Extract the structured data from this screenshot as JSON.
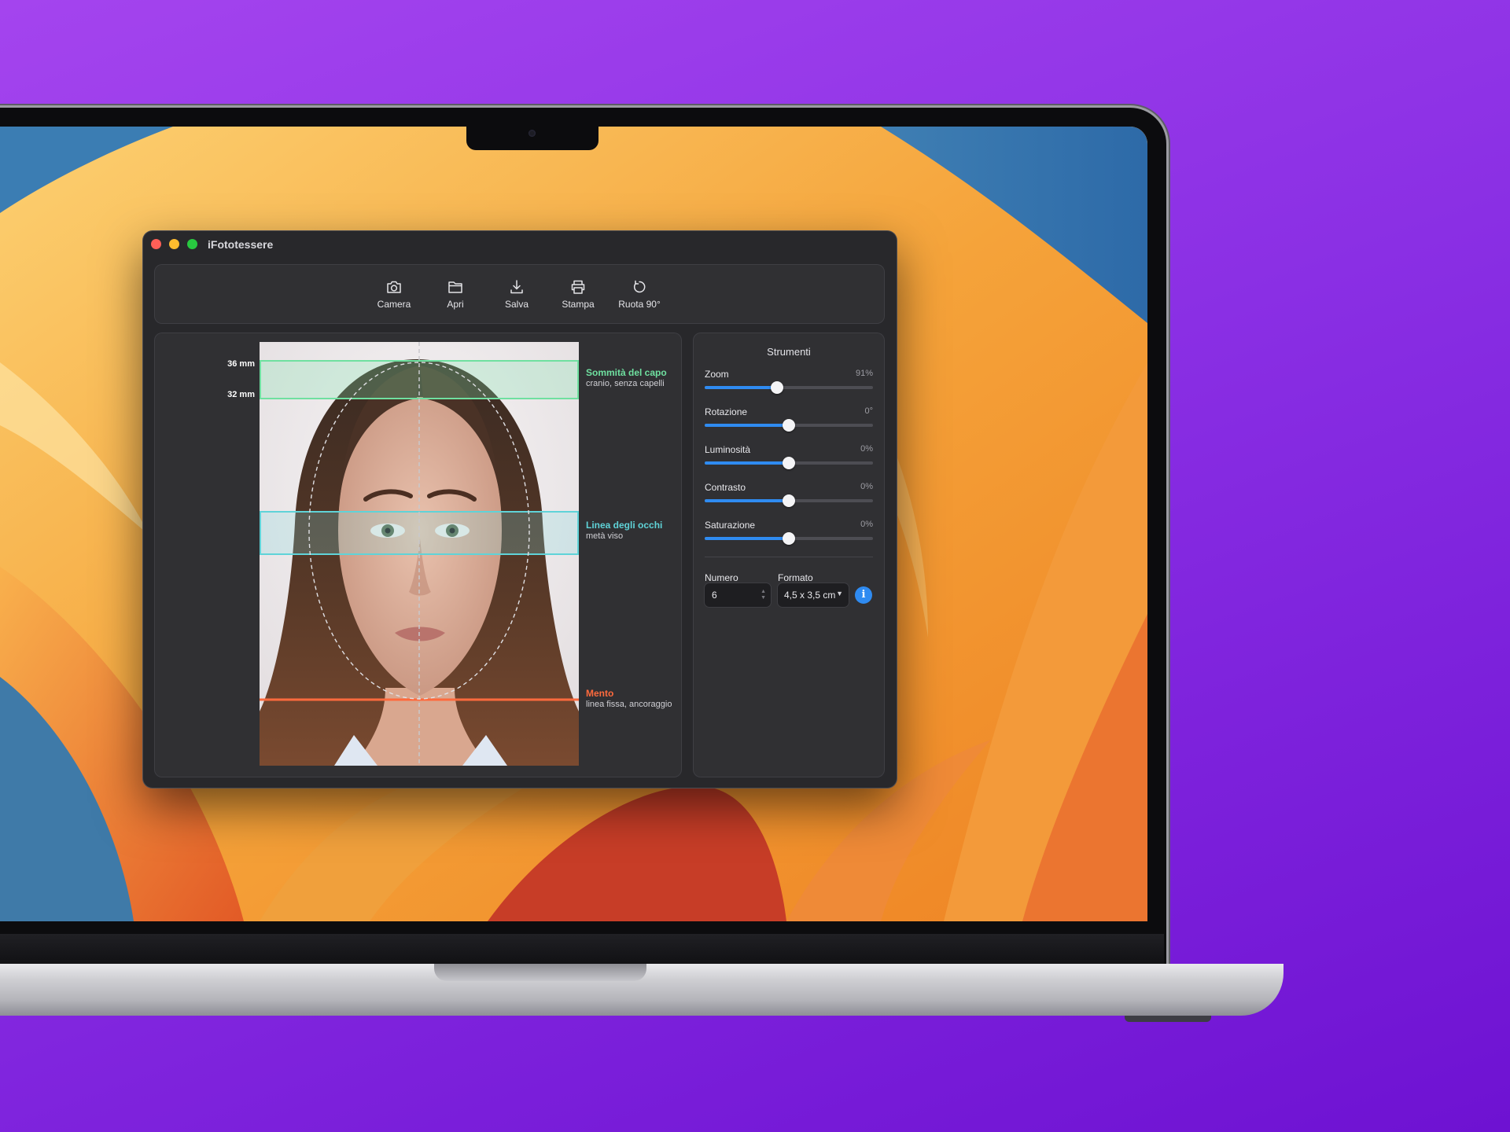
{
  "window": {
    "title": "iFototessere"
  },
  "toolbar": {
    "items": [
      {
        "label": "Camera",
        "icon": "camera-icon"
      },
      {
        "label": "Apri",
        "icon": "folder-icon"
      },
      {
        "label": "Salva",
        "icon": "download-icon"
      },
      {
        "label": "Stampa",
        "icon": "printer-icon"
      },
      {
        "label": "Ruota 90°",
        "icon": "rotate-icon"
      }
    ]
  },
  "photo": {
    "measures": {
      "top": "36 mm",
      "bottom": "32 mm"
    },
    "guides": {
      "head_top": {
        "title": "Sommità del capo",
        "subtitle": "cranio, senza capelli",
        "color": "#6fe0a0"
      },
      "eye_line": {
        "title": "Linea degli occhi",
        "subtitle": "metà viso",
        "color": "#5fd3d8"
      },
      "chin": {
        "title": "Mento",
        "subtitle": "linea fissa, ancoraggio",
        "color": "#ff6a3d"
      }
    }
  },
  "tools": {
    "title": "Strumenti",
    "sliders": [
      {
        "label": "Zoom",
        "value": "91%",
        "level": 0.43
      },
      {
        "label": "Rotazione",
        "value": "0°",
        "level": 0.5
      },
      {
        "label": "Luminosità",
        "value": "0%",
        "level": 0.5
      },
      {
        "label": "Contrasto",
        "value": "0%",
        "level": 0.5
      },
      {
        "label": "Saturazione",
        "value": "0%",
        "level": 0.5
      }
    ],
    "number_label": "Numero",
    "number_value": "6",
    "format_label": "Formato",
    "format_value": "4,5 x 3,5 cm",
    "info_icon": "i",
    "accent_color": "#2f8bf1"
  }
}
